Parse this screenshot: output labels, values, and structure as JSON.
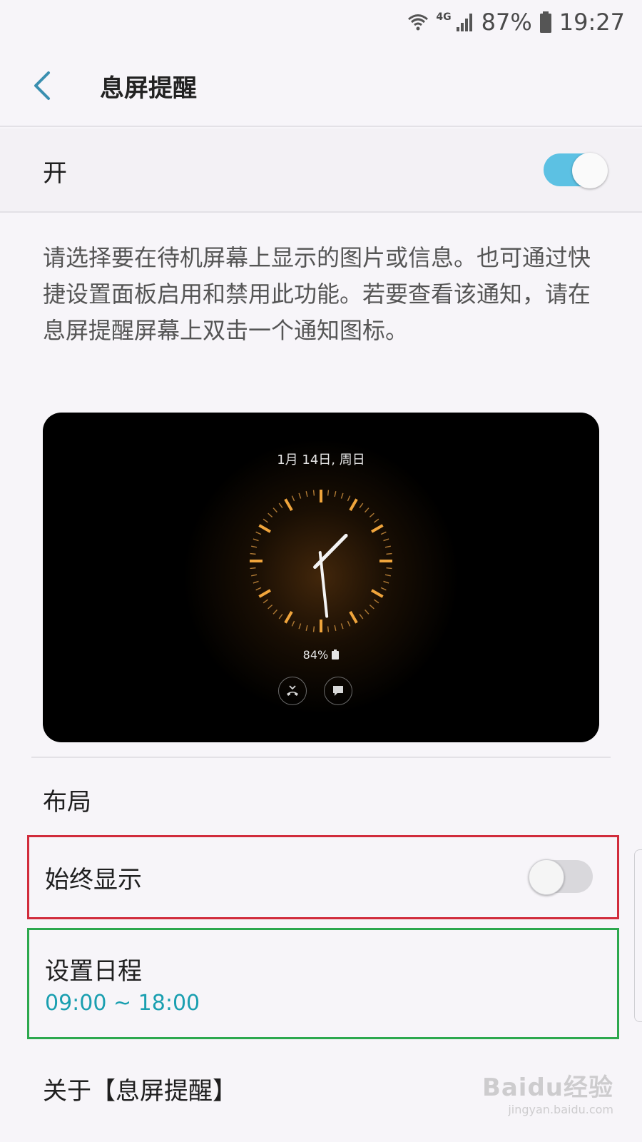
{
  "status_bar": {
    "network": "4G",
    "battery": "87%",
    "time": "19:27"
  },
  "header": {
    "title": "息屏提醒"
  },
  "master_switch": {
    "label": "开",
    "state": "on"
  },
  "description": "请选择要在待机屏幕上显示的图片或信息。也可通过快捷设置面板启用和禁用此功能。若要查看该通知，请在息屏提醒屏幕上双击一个通知图标。",
  "preview": {
    "date": "1月 14日, 周日",
    "battery": "84%",
    "clock_time": "13:29",
    "accent_color": "#f0a53c"
  },
  "list": {
    "layout_label": "布局",
    "always_on_label": "始终显示",
    "always_on_state": "off",
    "schedule_label": "设置日程",
    "schedule_value": "09:00 ~ 18:00",
    "about_label": "关于【息屏提醒】"
  },
  "colors": {
    "switch_on": "#5cc1e3",
    "schedule_text": "#1a9fb0",
    "highlight_red": "#d12c3c",
    "highlight_green": "#2da84e"
  },
  "watermark": {
    "main": "Baidu经验",
    "sub": "jingyan.baidu.com"
  }
}
